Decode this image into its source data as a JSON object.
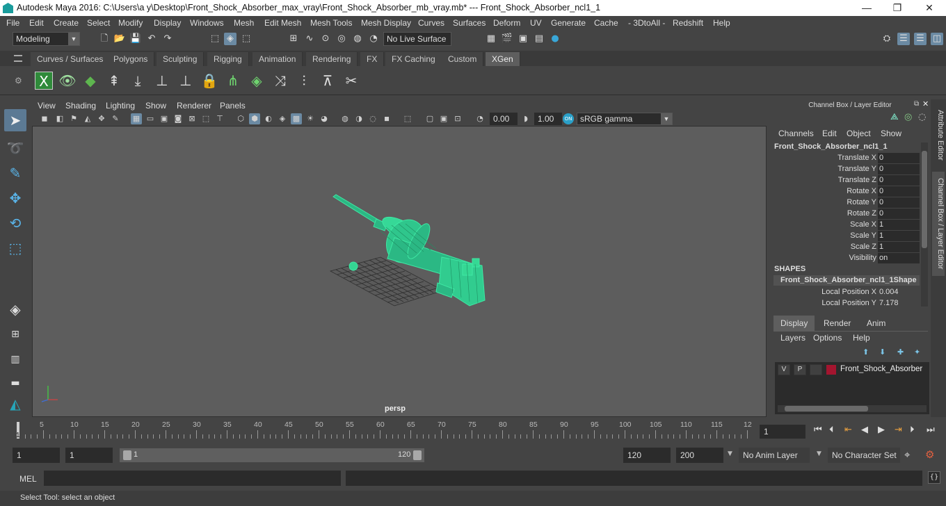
{
  "window": {
    "title": "Autodesk Maya 2016: C:\\Users\\a y\\Desktop\\Front_Shock_Absorber_max_vray\\Front_Shock_Absorber_mb_vray.mb*    ---    Front_Shock_Absorber_ncl1_1",
    "minimize": "—",
    "maximize": "❐",
    "close": "✕"
  },
  "menubar": [
    "File",
    "Edit",
    "Create",
    "Select",
    "Modify",
    "Display",
    "Windows",
    "Mesh",
    "Edit Mesh",
    "Mesh Tools",
    "Mesh Display",
    "Curves",
    "Surfaces",
    "Deform",
    "UV",
    "Generate",
    "Cache",
    "- 3DtoAll -",
    "Redshift",
    "Help"
  ],
  "statusline": {
    "mode": "Modeling",
    "live_surface": "No Live Surface"
  },
  "shelf_tabs": [
    {
      "label": "Curves / Surfaces",
      "active": false
    },
    {
      "label": "Polygons",
      "active": false
    },
    {
      "label": "Sculpting",
      "active": false
    },
    {
      "label": "Rigging",
      "active": false
    },
    {
      "label": "Animation",
      "active": false
    },
    {
      "label": "Rendering",
      "active": false
    },
    {
      "label": "FX",
      "active": false
    },
    {
      "label": "FX Caching",
      "active": false
    },
    {
      "label": "Custom",
      "active": false
    },
    {
      "label": "XGen",
      "active": true
    }
  ],
  "viewport": {
    "menu": [
      "View",
      "Shading",
      "Lighting",
      "Show",
      "Renderer",
      "Panels"
    ],
    "exposure": "0.00",
    "gamma": "1.00",
    "color_space": "sRGB gamma",
    "camera_label": "persp",
    "wire_color": "#3fe8a4"
  },
  "channel_box": {
    "title": "Channel Box / Layer Editor",
    "menu": [
      "Channels",
      "Edit",
      "Object",
      "Show"
    ],
    "object_name": "Front_Shock_Absorber_ncl1_1",
    "attributes": [
      {
        "label": "Translate X",
        "value": "0"
      },
      {
        "label": "Translate Y",
        "value": "0"
      },
      {
        "label": "Translate Z",
        "value": "0"
      },
      {
        "label": "Rotate X",
        "value": "0"
      },
      {
        "label": "Rotate Y",
        "value": "0"
      },
      {
        "label": "Rotate Z",
        "value": "0"
      },
      {
        "label": "Scale X",
        "value": "1"
      },
      {
        "label": "Scale Y",
        "value": "1"
      },
      {
        "label": "Scale Z",
        "value": "1"
      },
      {
        "label": "Visibility",
        "value": "on"
      }
    ],
    "shapes_header": "SHAPES",
    "shape_name": "Front_Shock_Absorber_ncl1_1Shape",
    "shape_attributes": [
      {
        "label": "Local Position X",
        "value": "0.004"
      },
      {
        "label": "Local Position Y",
        "value": "7.178"
      }
    ]
  },
  "layer_editor": {
    "tabs": [
      {
        "label": "Display",
        "active": true
      },
      {
        "label": "Render",
        "active": false
      },
      {
        "label": "Anim",
        "active": false
      }
    ],
    "menu": [
      "Layers",
      "Options",
      "Help"
    ],
    "layer": {
      "v": "V",
      "p": "P",
      "name": "Front_Shock_Absorber",
      "color": "#a4152f"
    }
  },
  "side_tabs": [
    "Attribute Editor",
    "Channel Box / Layer Editor"
  ],
  "timeslider": {
    "ticks": [
      "5",
      "10",
      "15",
      "20",
      "25",
      "30",
      "35",
      "40",
      "45",
      "50",
      "55",
      "60",
      "65",
      "70",
      "75",
      "80",
      "85",
      "90",
      "95",
      "100",
      "105",
      "110",
      "115",
      "12"
    ],
    "current_frame": "1",
    "current_frame_field": "1"
  },
  "range": {
    "start": "1",
    "playback_start": "1",
    "bar_start": "1",
    "bar_end": "120",
    "playback_end": "120",
    "end": "200",
    "anim_layer": "No Anim Layer",
    "character_set": "No Character Set"
  },
  "command": {
    "label": "MEL"
  },
  "helpline": "Select Tool: select an object"
}
